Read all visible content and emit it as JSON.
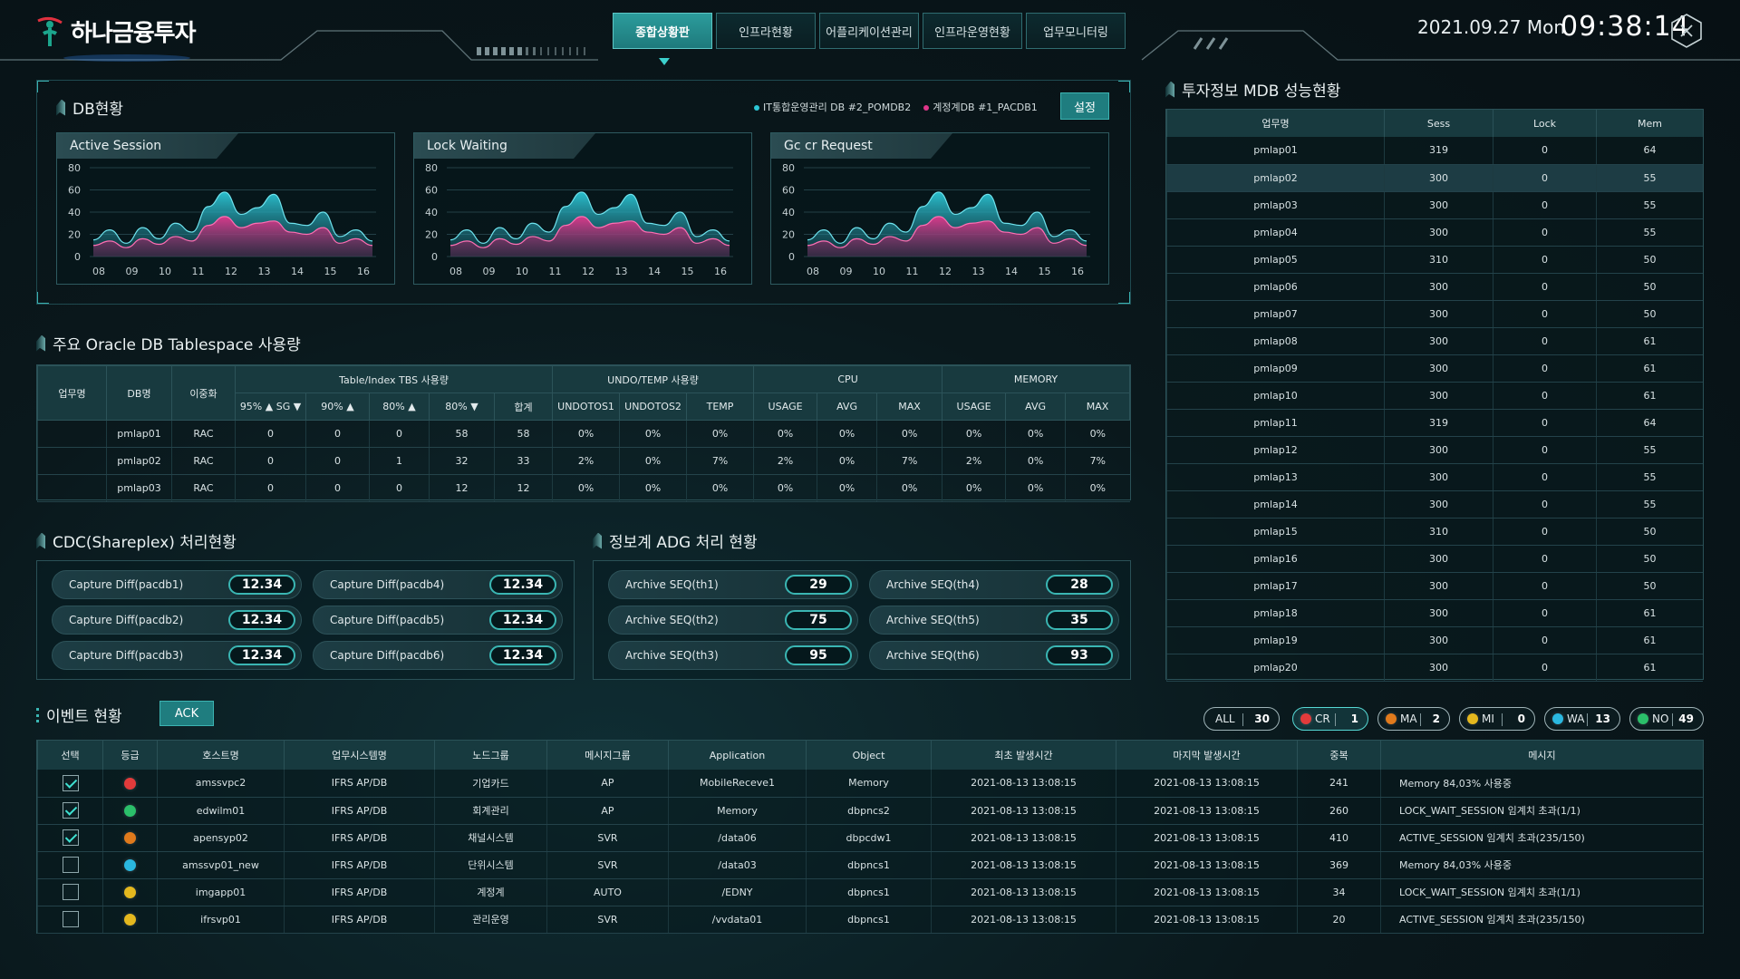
{
  "header": {
    "logo_text": "하나금융투자",
    "nav_tabs": [
      "종합상황판",
      "인프라현황",
      "어플리케이션관리",
      "인프라운영현황",
      "업무모니터링"
    ],
    "active_tab_index": 0,
    "date": "2021.09.27 Mon",
    "time": "09:38:14"
  },
  "db_status": {
    "title": "DB현황",
    "legend": [
      {
        "label": "IT통합운영관리 DB #2_POMDB2",
        "color": "#2cc7d6"
      },
      {
        "label": "계정계DB #1_PACDB1",
        "color": "#e0368a"
      }
    ],
    "settings_label": "설정",
    "charts": [
      {
        "title": "Active Session"
      },
      {
        "title": "Lock Waiting"
      },
      {
        "title": "Gc cr Request"
      }
    ]
  },
  "chart_data": [
    {
      "type": "area",
      "title": "Active Session",
      "x": [
        "08",
        "09",
        "10",
        "11",
        "12",
        "13",
        "14",
        "15",
        "16"
      ],
      "yticks": [
        "80",
        "60",
        "40",
        "20",
        "0"
      ],
      "ylim": [
        0,
        80
      ],
      "series": [
        {
          "name": "IT통합운영관리 DB #2_POMDB2",
          "values": [
            15,
            24,
            12,
            26,
            16,
            30,
            22,
            45,
            58,
            38,
            44,
            56,
            30,
            28,
            40,
            18,
            24,
            14
          ]
        },
        {
          "name": "계정계DB #1_PACDB1",
          "values": [
            10,
            14,
            8,
            16,
            11,
            18,
            14,
            28,
            36,
            26,
            30,
            32,
            22,
            20,
            26,
            12,
            16,
            10
          ]
        }
      ]
    },
    {
      "type": "area",
      "title": "Lock Waiting",
      "x": [
        "08",
        "09",
        "10",
        "11",
        "12",
        "13",
        "14",
        "15",
        "16"
      ],
      "yticks": [
        "80",
        "60",
        "40",
        "20",
        "0"
      ],
      "ylim": [
        0,
        80
      ],
      "series": [
        {
          "name": "IT통합운영관리 DB #2_POMDB2",
          "values": [
            15,
            24,
            12,
            26,
            16,
            30,
            22,
            45,
            58,
            38,
            44,
            56,
            30,
            28,
            40,
            18,
            24,
            14
          ]
        },
        {
          "name": "계정계DB #1_PACDB1",
          "values": [
            10,
            14,
            8,
            16,
            11,
            18,
            14,
            28,
            36,
            26,
            30,
            32,
            22,
            20,
            26,
            12,
            16,
            10
          ]
        }
      ]
    },
    {
      "type": "area",
      "title": "Gc cr Request",
      "x": [
        "08",
        "09",
        "10",
        "11",
        "12",
        "13",
        "14",
        "15",
        "16"
      ],
      "yticks": [
        "80",
        "60",
        "40",
        "20",
        "0"
      ],
      "ylim": [
        0,
        80
      ],
      "series": [
        {
          "name": "IT통합운영관리 DB #2_POMDB2",
          "values": [
            15,
            24,
            12,
            26,
            16,
            30,
            22,
            45,
            58,
            38,
            44,
            56,
            30,
            28,
            40,
            18,
            24,
            14
          ]
        },
        {
          "name": "계정계DB #1_PACDB1",
          "values": [
            10,
            14,
            8,
            16,
            11,
            18,
            14,
            28,
            36,
            26,
            30,
            32,
            22,
            20,
            26,
            12,
            16,
            10
          ]
        }
      ]
    }
  ],
  "tablespace": {
    "title": "주요 Oracle DB Tablespace 사용량",
    "group_headers": [
      "업무명",
      "DB명",
      "이중화",
      "Table/Index TBS 사용량",
      "UNDO/TEMP 사용량",
      "CPU",
      "MEMORY"
    ],
    "sub_headers": [
      "95% ▲ SG ▼",
      "90% ▲",
      "80% ▲",
      "80% ▼",
      "합계",
      "UNDOTOS1",
      "UNDOTOS2",
      "TEMP",
      "USAGE",
      "AVG",
      "MAX",
      "USAGE",
      "AVG",
      "MAX"
    ],
    "rows": [
      [
        "",
        "pmlap01",
        "RAC",
        "0",
        "0",
        "0",
        "58",
        "58",
        "0%",
        "0%",
        "0%",
        "0%",
        "0%",
        "0%",
        "0%",
        "0%",
        "0%"
      ],
      [
        "",
        "pmlap02",
        "RAC",
        "0",
        "0",
        "1",
        "32",
        "33",
        "2%",
        "0%",
        "7%",
        "2%",
        "0%",
        "7%",
        "2%",
        "0%",
        "7%"
      ],
      [
        "",
        "pmlap03",
        "RAC",
        "0",
        "0",
        "0",
        "12",
        "12",
        "0%",
        "0%",
        "0%",
        "0%",
        "0%",
        "0%",
        "0%",
        "0%",
        "0%"
      ]
    ]
  },
  "cdc": {
    "title": "CDC(Shareplex) 처리현황",
    "items": [
      {
        "label": "Capture Diff(pacdb1)",
        "value": "12.34"
      },
      {
        "label": "Capture Diff(pacdb4)",
        "value": "12.34"
      },
      {
        "label": "Capture Diff(pacdb2)",
        "value": "12.34"
      },
      {
        "label": "Capture Diff(pacdb5)",
        "value": "12.34"
      },
      {
        "label": "Capture Diff(pacdb3)",
        "value": "12.34"
      },
      {
        "label": "Capture Diff(pacdb6)",
        "value": "12.34"
      }
    ]
  },
  "adg": {
    "title": "정보계 ADG 처리 현황",
    "items": [
      {
        "label": "Archive SEQ(th1)",
        "value": "29"
      },
      {
        "label": "Archive SEQ(th4)",
        "value": "28"
      },
      {
        "label": "Archive SEQ(th2)",
        "value": "75"
      },
      {
        "label": "Archive SEQ(th5)",
        "value": "35"
      },
      {
        "label": "Archive SEQ(th3)",
        "value": "95"
      },
      {
        "label": "Archive SEQ(th6)",
        "value": "93"
      }
    ]
  },
  "mdb": {
    "title": "투자정보 MDB 성능현황",
    "headers": [
      "업무명",
      "Sess",
      "Lock",
      "Mem"
    ],
    "selected_row": 1,
    "rows": [
      [
        "pmlap01",
        "319",
        "0",
        "64"
      ],
      [
        "pmlap02",
        "300",
        "0",
        "55"
      ],
      [
        "pmlap03",
        "300",
        "0",
        "55"
      ],
      [
        "pmlap04",
        "300",
        "0",
        "55"
      ],
      [
        "pmlap05",
        "310",
        "0",
        "50"
      ],
      [
        "pmlap06",
        "300",
        "0",
        "50"
      ],
      [
        "pmlap07",
        "300",
        "0",
        "50"
      ],
      [
        "pmlap08",
        "300",
        "0",
        "61"
      ],
      [
        "pmlap09",
        "300",
        "0",
        "61"
      ],
      [
        "pmlap10",
        "300",
        "0",
        "61"
      ],
      [
        "pmlap11",
        "319",
        "0",
        "64"
      ],
      [
        "pmlap12",
        "300",
        "0",
        "55"
      ],
      [
        "pmlap13",
        "300",
        "0",
        "55"
      ],
      [
        "pmlap14",
        "300",
        "0",
        "55"
      ],
      [
        "pmlap15",
        "310",
        "0",
        "50"
      ],
      [
        "pmlap16",
        "300",
        "0",
        "50"
      ],
      [
        "pmlap17",
        "300",
        "0",
        "50"
      ],
      [
        "pmlap18",
        "300",
        "0",
        "61"
      ],
      [
        "pmlap19",
        "300",
        "0",
        "61"
      ],
      [
        "pmlap20",
        "300",
        "0",
        "61"
      ]
    ]
  },
  "events": {
    "title": "이벤트 현황",
    "ack_label": "ACK",
    "filters": [
      {
        "label": "ALL",
        "count": "30",
        "color": ""
      },
      {
        "label": "CR",
        "count": "1",
        "color": "#e23b3b"
      },
      {
        "label": "MA",
        "count": "2",
        "color": "#e07a1c"
      },
      {
        "label": "MI",
        "count": "0",
        "color": "#e4b81e"
      },
      {
        "label": "WA",
        "count": "13",
        "color": "#2ab8e0"
      },
      {
        "label": "NO",
        "count": "49",
        "color": "#2bbf6a"
      }
    ],
    "active_filter_index": 1,
    "headers": [
      "선택",
      "등급",
      "호스트명",
      "업무시스템명",
      "노드그룹",
      "메시지그룹",
      "Application",
      "Object",
      "최초 발생시간",
      "마지막 발생시간",
      "중복",
      "메시지"
    ],
    "rows": [
      {
        "checked": true,
        "grade_color": "#e23b3b",
        "cells": [
          "amssvpc2",
          "IFRS AP/DB",
          "기업카드",
          "AP",
          "MobileReceve1",
          "Memory",
          "2021-08-13 13:08:15",
          "2021-08-13 13:08:15",
          "241",
          "Memory 84,03% 사용중"
        ]
      },
      {
        "checked": true,
        "grade_color": "#2bbf6a",
        "cells": [
          "edwilm01",
          "IFRS AP/DB",
          "회계관리",
          "AP",
          "Memory",
          "dbpncs2",
          "2021-08-13 13:08:15",
          "2021-08-13 13:08:15",
          "260",
          "LOCK_WAIT_SESSION 임계치 초과(1/1)"
        ]
      },
      {
        "checked": true,
        "grade_color": "#e07a1c",
        "cells": [
          "apensyp02",
          "IFRS AP/DB",
          "채널시스템",
          "SVR",
          "/data06",
          "dbpcdw1",
          "2021-08-13 13:08:15",
          "2021-08-13 13:08:15",
          "410",
          "ACTIVE_SESSION 임계치 초과(235/150)"
        ]
      },
      {
        "checked": false,
        "grade_color": "#2ab8e0",
        "cells": [
          "amssvp01_new",
          "IFRS AP/DB",
          "단위시스템",
          "SVR",
          "/data03",
          "dbpncs1",
          "2021-08-13 13:08:15",
          "2021-08-13 13:08:15",
          "369",
          "Memory 84,03% 사용중"
        ]
      },
      {
        "checked": false,
        "grade_color": "#e4b81e",
        "cells": [
          "imgapp01",
          "IFRS AP/DB",
          "계정계",
          "AUTO",
          "/EDNY",
          "dbpncs1",
          "2021-08-13 13:08:15",
          "2021-08-13 13:08:15",
          "34",
          "LOCK_WAIT_SESSION 임계치 초과(1/1)"
        ]
      },
      {
        "checked": false,
        "grade_color": "#e4b81e",
        "cells": [
          "ifrsvp01",
          "IFRS AP/DB",
          "관리운영",
          "SVR",
          "/vvdata01",
          "dbpncs1",
          "2021-08-13 13:08:15",
          "2021-08-13 13:08:15",
          "20",
          "ACTIVE_SESSION 임계치 초과(235/150)"
        ]
      }
    ]
  }
}
